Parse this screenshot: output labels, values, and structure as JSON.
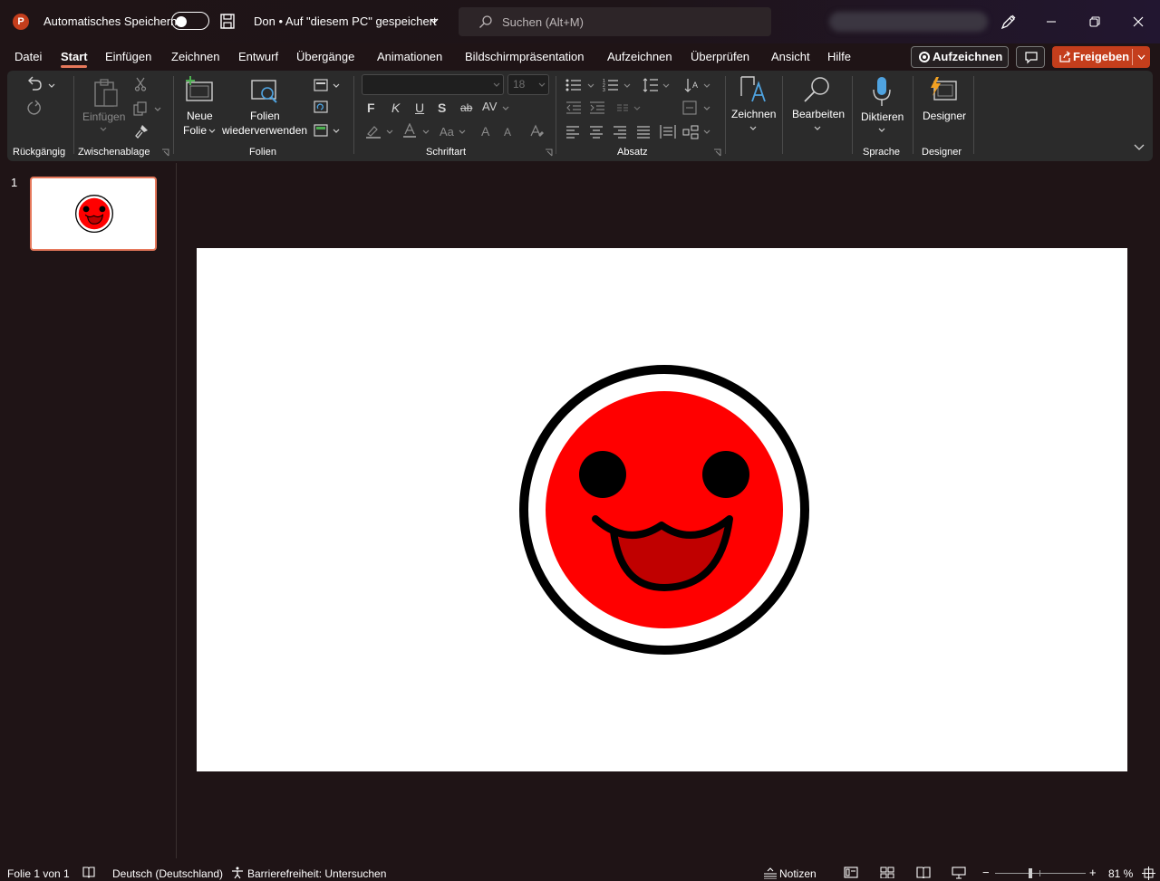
{
  "titlebar": {
    "app_logo": "P",
    "autosave_label": "Automatisches Speichern",
    "doc_title": "Don • Auf \"diesem PC\" gespeichert",
    "search_placeholder": "Suchen (Alt+M)"
  },
  "menu": {
    "tabs": [
      "Datei",
      "Start",
      "Einfügen",
      "Zeichnen",
      "Entwurf",
      "Übergänge",
      "Animationen",
      "Bildschirmpräsentation",
      "Aufzeichnen",
      "Überprüfen",
      "Ansicht",
      "Hilfe"
    ],
    "active_tab": "Start",
    "record_label": "Aufzeichnen",
    "share_label": "Freigeben"
  },
  "ribbon": {
    "groups": {
      "undo": "Rückgängig",
      "clipboard": "Zwischenablage",
      "slides": "Folien",
      "font": "Schriftart",
      "paragraph": "Absatz",
      "speech": "Sprache",
      "designer": "Designer"
    },
    "paste_label": "Einfügen",
    "new_slide_label_1": "Neue",
    "new_slide_label_2": "Folie",
    "reuse_label_1": "Folien",
    "reuse_label_2": "wiederverwenden",
    "font_name": "",
    "font_size": "18",
    "bold": "F",
    "italic": "K",
    "underline": "U",
    "shadow": "S",
    "strike": "ab",
    "spacing": "AV",
    "case": "Aa",
    "grow": "A",
    "shrink": "A",
    "draw_label": "Zeichnen",
    "edit_label": "Bearbeiten",
    "dictate_label": "Diktieren",
    "designer_label": "Designer"
  },
  "thumbnails": {
    "slide_number": "1"
  },
  "statusbar": {
    "slide_info": "Folie 1 von 1",
    "language": "Deutsch (Deutschland)",
    "accessibility": "Barrierefreiheit: Untersuchen",
    "notes": "Notizen",
    "zoom_minus": "−",
    "zoom_plus": "+",
    "zoom": "81 %"
  },
  "colors": {
    "accent": "#e6785b",
    "share_button": "#c43e1c",
    "face_red": "#ff0000",
    "mouth_dark_red": "#c00000",
    "outline": "#000000"
  }
}
